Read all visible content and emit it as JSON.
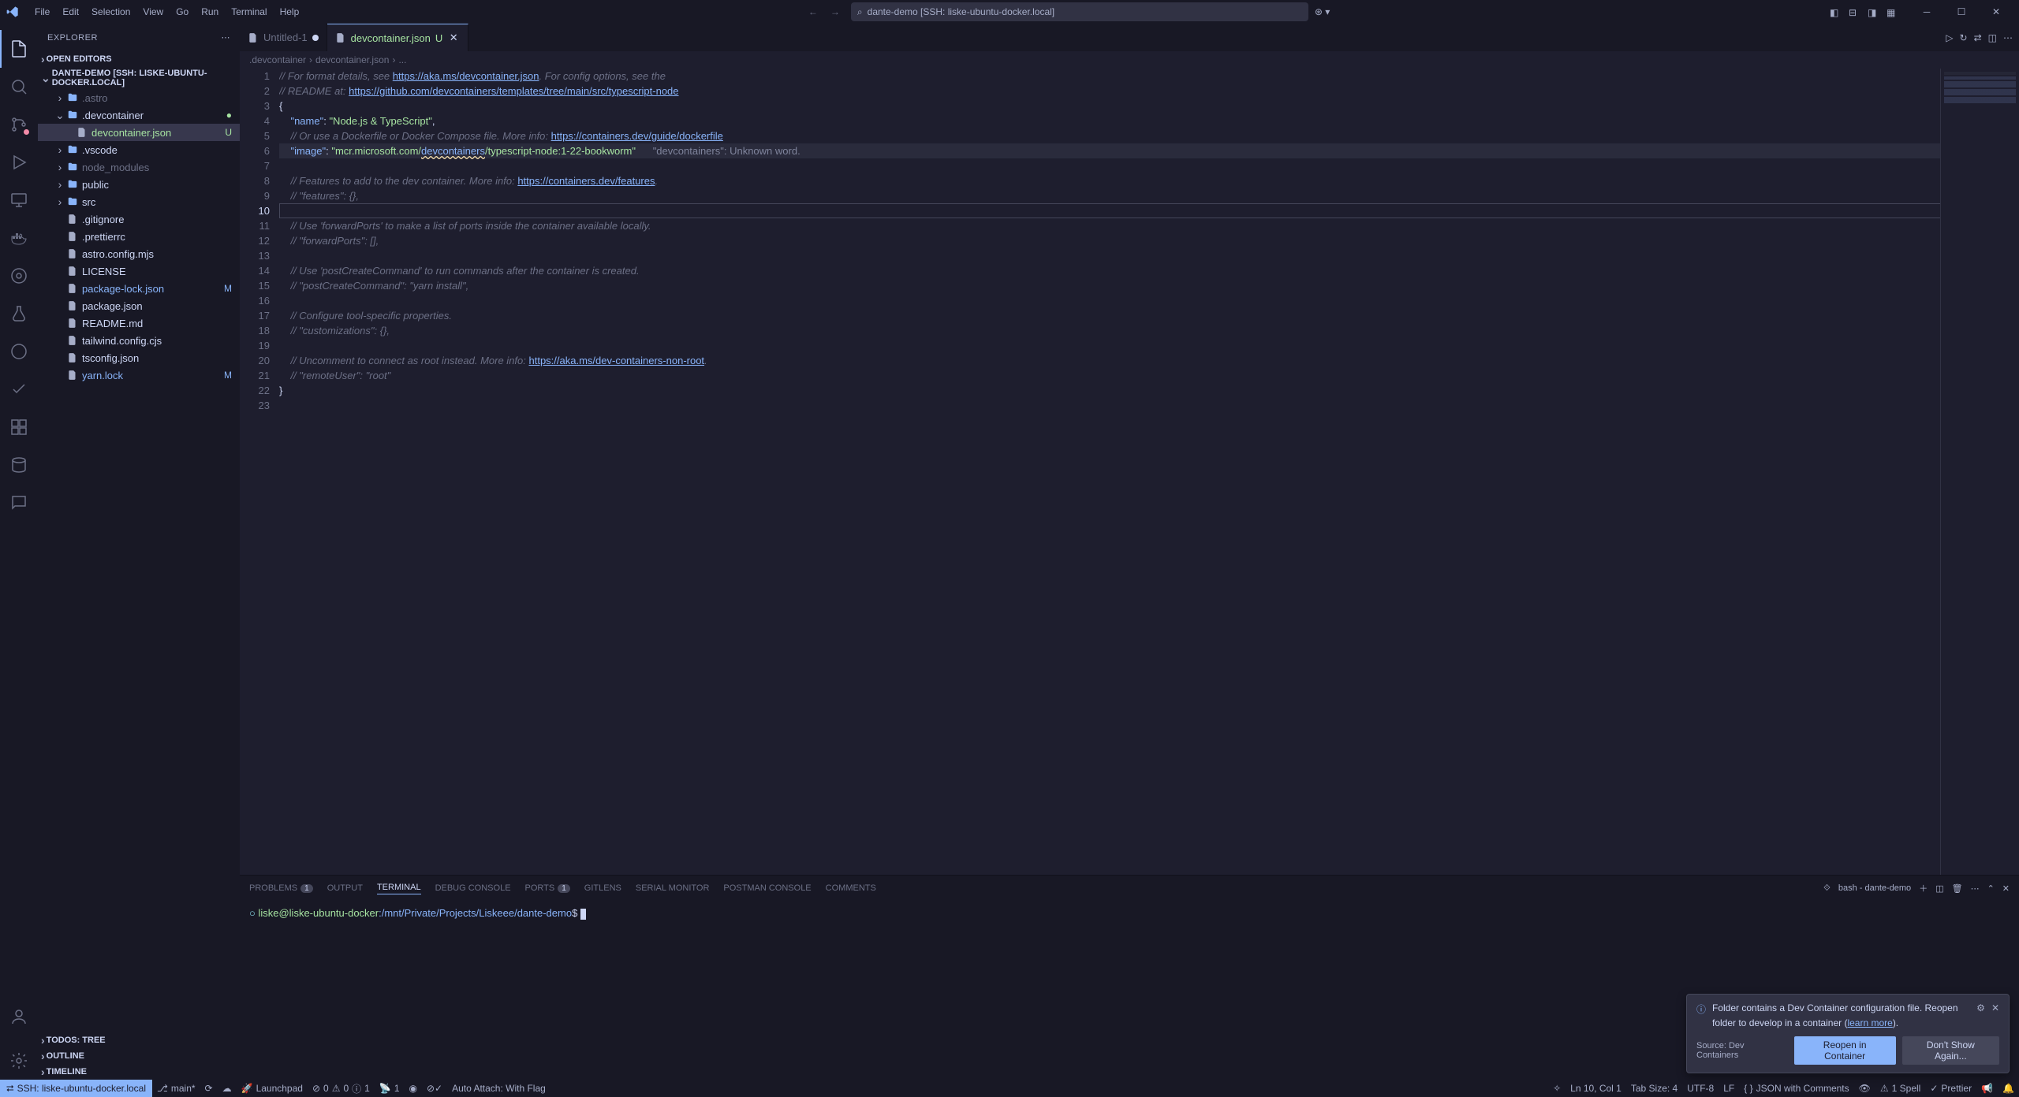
{
  "titlebar": {
    "menus": [
      "File",
      "Edit",
      "Selection",
      "View",
      "Go",
      "Run",
      "Terminal",
      "Help"
    ],
    "search_text": "dante-demo [SSH: liske-ubuntu-docker.local]"
  },
  "sidebar": {
    "title": "EXPLORER",
    "sections": {
      "open_editors": "OPEN EDITORS",
      "project": "DANTE-DEMO [SSH: LISKE-UBUNTU-DOCKER.LOCAL]",
      "todos": "TODOS: TREE",
      "outline": "OUTLINE",
      "timeline": "TIMELINE"
    },
    "tree": [
      {
        "type": "folder",
        "name": ".astro",
        "depth": 1,
        "expanded": false,
        "dimmed": true,
        "chev": true
      },
      {
        "type": "folder",
        "name": ".devcontainer",
        "depth": 1,
        "expanded": true,
        "badge": "●",
        "badgeClass": "dot",
        "chev": true
      },
      {
        "type": "file",
        "name": "devcontainer.json",
        "depth": 2,
        "selected": true,
        "git": "u",
        "badge": "U"
      },
      {
        "type": "folder",
        "name": ".vscode",
        "depth": 1,
        "expanded": false,
        "chev": true
      },
      {
        "type": "folder",
        "name": "node_modules",
        "depth": 1,
        "expanded": false,
        "dimmed": true,
        "chev": true
      },
      {
        "type": "folder",
        "name": "public",
        "depth": 1,
        "expanded": false,
        "chev": true
      },
      {
        "type": "folder",
        "name": "src",
        "depth": 1,
        "expanded": false,
        "chev": true
      },
      {
        "type": "file",
        "name": ".gitignore",
        "depth": 1
      },
      {
        "type": "file",
        "name": ".prettierrc",
        "depth": 1
      },
      {
        "type": "file",
        "name": "astro.config.mjs",
        "depth": 1
      },
      {
        "type": "file",
        "name": "LICENSE",
        "depth": 1
      },
      {
        "type": "file",
        "name": "package-lock.json",
        "depth": 1,
        "git": "m",
        "badge": "M"
      },
      {
        "type": "file",
        "name": "package.json",
        "depth": 1
      },
      {
        "type": "file",
        "name": "README.md",
        "depth": 1
      },
      {
        "type": "file",
        "name": "tailwind.config.cjs",
        "depth": 1
      },
      {
        "type": "file",
        "name": "tsconfig.json",
        "depth": 1
      },
      {
        "type": "file",
        "name": "yarn.lock",
        "depth": 1,
        "git": "m",
        "badge": "M"
      }
    ]
  },
  "tabs": [
    {
      "label": "Untitled-1",
      "active": false,
      "modified": true,
      "git": ""
    },
    {
      "label": "devcontainer.json",
      "active": true,
      "modified": false,
      "git": "U"
    }
  ],
  "breadcrumb": [
    ".devcontainer",
    "devcontainer.json",
    "..."
  ],
  "code": {
    "lines": [
      {
        "n": 1,
        "segs": [
          [
            "c-comment",
            "// For format details, see "
          ],
          [
            "c-link",
            "https://aka.ms/devcontainer.json"
          ],
          [
            "c-comment",
            ". For config options, see the"
          ]
        ]
      },
      {
        "n": 2,
        "segs": [
          [
            "c-comment",
            "// README at: "
          ],
          [
            "c-link",
            "https://github.com/devcontainers/templates/tree/main/src/typescript-node"
          ]
        ]
      },
      {
        "n": 3,
        "segs": [
          [
            "c-punc",
            "{"
          ]
        ]
      },
      {
        "n": 4,
        "segs": [
          [
            "",
            "    "
          ],
          [
            "c-key",
            "\"name\""
          ],
          [
            "c-punc",
            ": "
          ],
          [
            "c-string",
            "\"Node.js & TypeScript\""
          ],
          [
            "c-punc",
            ","
          ]
        ]
      },
      {
        "n": 5,
        "segs": [
          [
            "",
            "    "
          ],
          [
            "c-comment",
            "// Or use a Dockerfile or Docker Compose file. More info: "
          ],
          [
            "c-link",
            "https://containers.dev/guide/dockerfile"
          ]
        ]
      },
      {
        "n": 6,
        "hl": true,
        "segs": [
          [
            "",
            "    "
          ],
          [
            "c-key",
            "\"image\""
          ],
          [
            "c-punc",
            ": "
          ],
          [
            "c-string",
            "\"mcr.microsoft.com/"
          ],
          [
            "c-warn",
            "devcontainers"
          ],
          [
            "c-string",
            "/typescript-node:1-22-bookworm\""
          ],
          [
            "",
            "      "
          ],
          [
            "c-hint",
            "\"devcontainers\": Unknown word."
          ]
        ]
      },
      {
        "n": 7,
        "segs": []
      },
      {
        "n": 8,
        "segs": [
          [
            "",
            "    "
          ],
          [
            "c-comment",
            "// Features to add to the dev container. More info: "
          ],
          [
            "c-link",
            "https://containers.dev/features"
          ],
          [
            "c-comment",
            "."
          ]
        ]
      },
      {
        "n": 9,
        "segs": [
          [
            "",
            "    "
          ],
          [
            "c-comment",
            "// \"features\": {},"
          ]
        ]
      },
      {
        "n": 10,
        "cursor": true,
        "segs": []
      },
      {
        "n": 11,
        "segs": [
          [
            "",
            "    "
          ],
          [
            "c-comment",
            "// Use 'forwardPorts' to make a list of ports inside the container available locally."
          ]
        ]
      },
      {
        "n": 12,
        "segs": [
          [
            "",
            "    "
          ],
          [
            "c-comment",
            "// \"forwardPorts\": [],"
          ]
        ]
      },
      {
        "n": 13,
        "segs": []
      },
      {
        "n": 14,
        "segs": [
          [
            "",
            "    "
          ],
          [
            "c-comment",
            "// Use 'postCreateCommand' to run commands after the container is created."
          ]
        ]
      },
      {
        "n": 15,
        "segs": [
          [
            "",
            "    "
          ],
          [
            "c-comment",
            "// \"postCreateCommand\": \"yarn install\","
          ]
        ]
      },
      {
        "n": 16,
        "segs": []
      },
      {
        "n": 17,
        "segs": [
          [
            "",
            "    "
          ],
          [
            "c-comment",
            "// Configure tool-specific properties."
          ]
        ]
      },
      {
        "n": 18,
        "segs": [
          [
            "",
            "    "
          ],
          [
            "c-comment",
            "// \"customizations\": {},"
          ]
        ]
      },
      {
        "n": 19,
        "segs": []
      },
      {
        "n": 20,
        "segs": [
          [
            "",
            "    "
          ],
          [
            "c-comment",
            "// Uncomment to connect as root instead. More info: "
          ],
          [
            "c-link",
            "https://aka.ms/dev-containers-non-root"
          ],
          [
            "c-comment",
            "."
          ]
        ]
      },
      {
        "n": 21,
        "segs": [
          [
            "",
            "    "
          ],
          [
            "c-comment",
            "// \"remoteUser\": \"root\""
          ]
        ]
      },
      {
        "n": 22,
        "segs": [
          [
            "c-punc",
            "}"
          ]
        ]
      },
      {
        "n": 23,
        "segs": []
      }
    ]
  },
  "panel": {
    "tabs": [
      {
        "label": "PROBLEMS",
        "badge": "1"
      },
      {
        "label": "OUTPUT"
      },
      {
        "label": "TERMINAL",
        "active": true
      },
      {
        "label": "DEBUG CONSOLE"
      },
      {
        "label": "PORTS",
        "badge": "1"
      },
      {
        "label": "GITLENS"
      },
      {
        "label": "SERIAL MONITOR"
      },
      {
        "label": "POSTMAN CONSOLE"
      },
      {
        "label": "COMMENTS"
      }
    ],
    "terminal_label": "bash - dante-demo",
    "prompt_user": "liske@liske-ubuntu-docker",
    "prompt_path": ":/mnt/Private/Projects/Liskeee/dante-demo",
    "prompt_suffix": "$ "
  },
  "statusbar": {
    "remote": "SSH: liske-ubuntu-docker.local",
    "branch": "main*",
    "launchpad": "Launchpad",
    "diag": "0  0  1",
    "ports": "1",
    "live": "",
    "auto_attach": "Auto Attach: With Flag",
    "ln_col": "Ln 10, Col 1",
    "tab_size": "Tab Size: 4",
    "encoding": "UTF-8",
    "eol": "LF",
    "lang": "JSON with Comments",
    "spell": "1 Spell",
    "prettier": "Prettier"
  },
  "notification": {
    "text1": "Folder contains a Dev Container configuration file. Reopen",
    "text2": "folder to develop in a container (",
    "learn": "learn more",
    "text3": ").",
    "source": "Source: Dev Containers",
    "btn_primary": "Reopen in Container",
    "btn_secondary": "Don't Show Again..."
  }
}
